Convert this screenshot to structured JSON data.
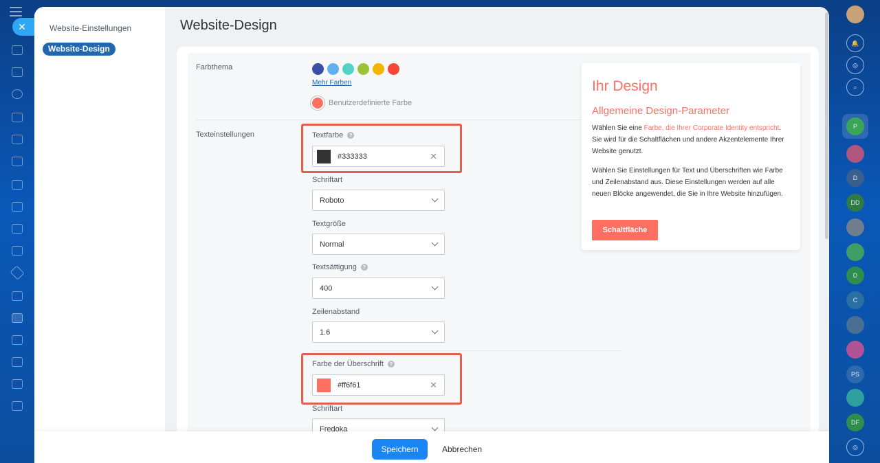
{
  "sidebar": {
    "title": "Website-Einstellungen",
    "active_item": "Website-Design"
  },
  "page_title": "Website-Design",
  "theme": {
    "label": "Farbthema",
    "swatches": [
      "#3b4ea8",
      "#62b1ef",
      "#55d2c6",
      "#9bc338",
      "#f4b400",
      "#f4473a"
    ],
    "more_colors": "Mehr Farben",
    "custom_label": "Benutzerdefinierte Farbe",
    "custom_color": "#ff6f61"
  },
  "text_settings": {
    "label": "Texteinstellungen",
    "text_color_label": "Textfarbe",
    "text_color_value": "#333333",
    "font_label": "Schriftart",
    "font_value": "Roboto",
    "size_label": "Textgröße",
    "size_value": "Normal",
    "weight_label": "Textsättigung",
    "weight_value": "400",
    "line_height_label": "Zeilenabstand",
    "line_height_value": "1.6",
    "heading_color_label": "Farbe der Überschrift",
    "heading_color_value": "#ff6f61",
    "heading_font_label": "Schriftart",
    "heading_font_value": "Fredoka"
  },
  "preview": {
    "title": "Ihr Design",
    "subtitle": "Allgemeine Design-Parameter",
    "p1_start": "Wählen Sie eine ",
    "p1_accent": "Farbe, die Ihrer Corporate Identity entspricht",
    "p1_end": ". Sie wird für die Schaltflächen und andere Akzentelemente Ihrer Website genutzt.",
    "p2": "Wählen Sie Einstellungen für Text und Überschriften wie Farbe und Zeilenabstand aus. Diese Einstellungen werden auf alle neuen Blöcke angewendet, die Sie in Ihre Website hinzufügen.",
    "button": "Schaltfläche"
  },
  "footer": {
    "save": "Speichern",
    "cancel": "Abbrechen"
  },
  "right_rail": [
    "P",
    "D",
    "DD",
    "D",
    "C",
    "PS",
    "DF"
  ]
}
